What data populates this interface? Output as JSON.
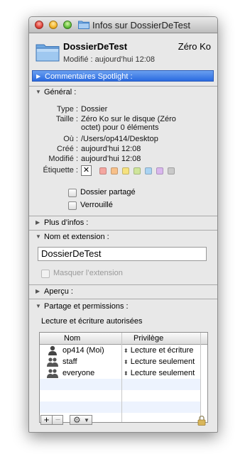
{
  "window": {
    "title": "Infos sur DossierDeTest"
  },
  "header": {
    "name": "DossierDeTest",
    "size": "Zéro Ko",
    "modified": "Modifié : aujourd’hui 12:08"
  },
  "spotlight": {
    "label": "Commentaires Spotlight :"
  },
  "general": {
    "label": "Général :",
    "rows": [
      {
        "key": "Type :",
        "value": "Dossier"
      },
      {
        "key": "Taille :",
        "value": "Zéro Ko sur le disque (Zéro octet) pour 0 éléments"
      },
      {
        "key": "Où :",
        "value": "/Users/op414/Desktop"
      },
      {
        "key": "Créé :",
        "value": "aujourd’hui 12:08"
      },
      {
        "key": "Modifié :",
        "value": "aujourd’hui 12:08"
      }
    ],
    "label_key": "Étiquette :",
    "label_colors": [
      "#f4a6a0",
      "#f7c08a",
      "#f6e27f",
      "#cfe59b",
      "#a9d3f2",
      "#d9b7ee",
      "#c9c9c9"
    ],
    "shared_folder": "Dossier partagé",
    "locked": "Verrouillé"
  },
  "more_info": {
    "label": "Plus d’infos :"
  },
  "name_ext": {
    "label": "Nom et extension :",
    "value": "DossierDeTest",
    "hide_extension": "Masquer l’extension"
  },
  "preview": {
    "label": "Aperçu :"
  },
  "sharing": {
    "label": "Partage et permissions :",
    "info": "Lecture et écriture autorisées",
    "col_name": "Nom",
    "col_privilege": "Privilège",
    "rows": [
      {
        "name": "op414 (Moi)",
        "privilege": "Lecture et écriture",
        "icon": "user-icon"
      },
      {
        "name": "staff",
        "privilege": "Lecture seulement",
        "icon": "group-icon"
      },
      {
        "name": "everyone",
        "privilege": "Lecture seulement",
        "icon": "group-icon"
      }
    ]
  },
  "toolbar": {
    "add": "+",
    "remove": "−"
  }
}
